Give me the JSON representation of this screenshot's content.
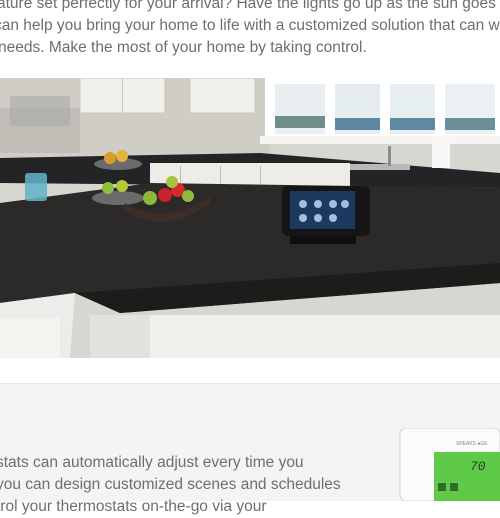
{
  "intro": {
    "line1": "ature set perfectly for your arrival? Have the lights go up as the sun goes do",
    "line2": " can help you bring your home to life with a customized solution that can w",
    "line3": "needs. Make the most of your home by taking control."
  },
  "hero": {
    "image_subject": "kitchen-with-touchscreen-controller"
  },
  "section2": {
    "line1": "stats can automatically adjust every time you",
    "line2": "you can design customized scenes and schedules",
    "line3": "trol your thermostats on-the-go via your"
  },
  "thermostat": {
    "brand": "SPEAKS ●GE",
    "display_temp": "70"
  },
  "colors": {
    "body_text": "#6e6e6e",
    "section_bg": "#f4f4f4",
    "thermostat_screen": "#5fc948"
  }
}
